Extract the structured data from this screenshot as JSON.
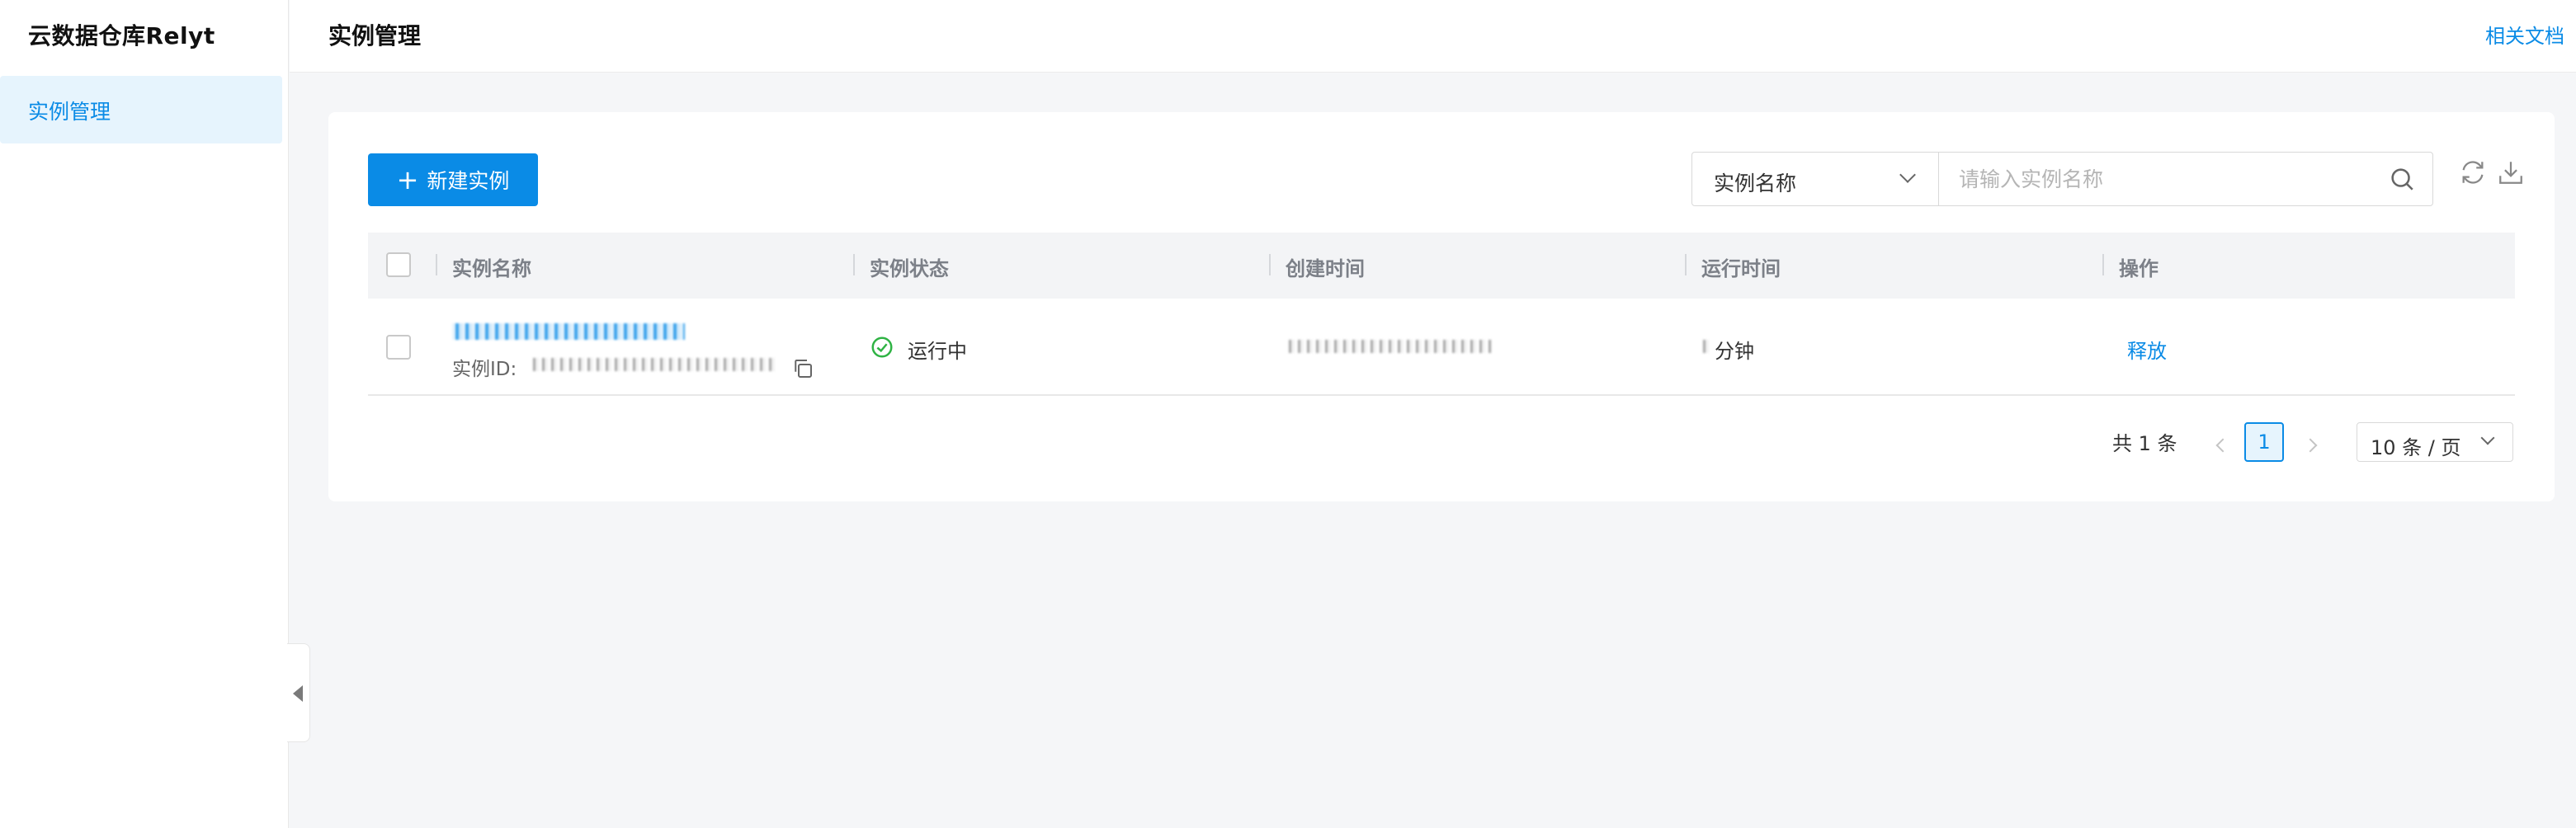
{
  "sidebar": {
    "title": "云数据仓库Relyt",
    "items": [
      {
        "label": "实例管理",
        "active": true
      }
    ]
  },
  "header": {
    "title": "实例管理",
    "docs_link": "相关文档"
  },
  "toolbar": {
    "new_button_label": "新建实例",
    "filter_field": "实例名称",
    "search_placeholder": "请输入实例名称",
    "icons": [
      "refresh-icon",
      "download-icon",
      "search-icon"
    ]
  },
  "table": {
    "columns": [
      "实例名称",
      "实例状态",
      "创建时间",
      "运行时间",
      "操作"
    ],
    "rows": [
      {
        "id_label": "实例ID:",
        "status": "运行中",
        "runtime_suffix": "分钟",
        "action": "释放"
      }
    ]
  },
  "pagination": {
    "total": "共 1 条",
    "current_page": "1",
    "page_size": "10 条 / 页"
  },
  "colors": {
    "accent": "#0a8be6",
    "status_ok": "#2fb344"
  }
}
